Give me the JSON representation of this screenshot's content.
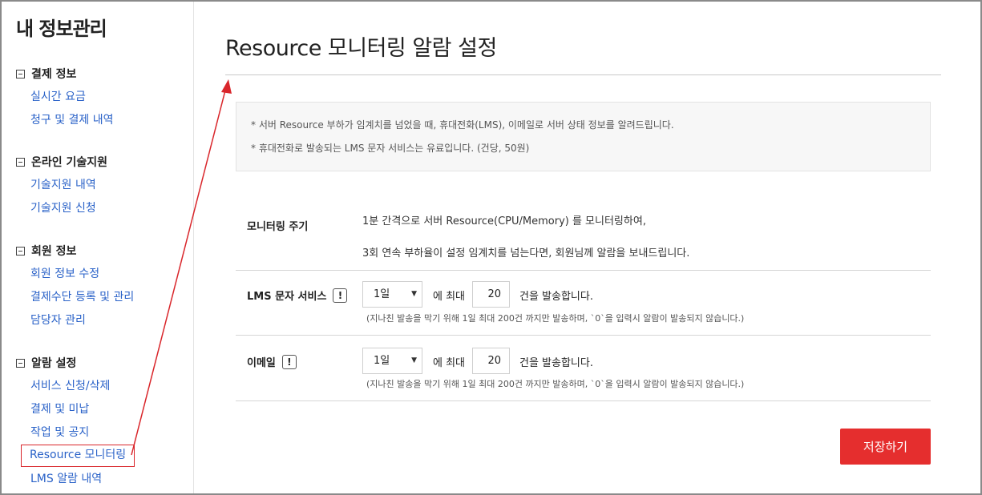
{
  "sidebar": {
    "title": "내 정보관리",
    "groups": [
      {
        "label": "결제 정보",
        "items": [
          "실시간 요금",
          "청구 및 결제 내역"
        ]
      },
      {
        "label": "온라인 기술지원",
        "items": [
          "기술지원 내역",
          "기술지원 신청"
        ]
      },
      {
        "label": "회원 정보",
        "items": [
          "회원 정보 수정",
          "결제수단 등록 및 관리",
          "담당자 관리"
        ]
      },
      {
        "label": "알람 설정",
        "items": [
          "서비스 신청/삭제",
          "결제 및 미납",
          "작업 및 공지",
          "Resource 모니터링",
          "LMS 알람 내역"
        ]
      }
    ]
  },
  "main": {
    "title": "Resource 모니터링 알람 설정",
    "notice": [
      "* 서버 Resource 부하가 임계치를 넘었을 때, 휴대전화(LMS), 이메일로 서버 상태 정보를 알려드립니다.",
      "* 휴대전화로 발송되는 LMS 문자 서비스는 유료입니다. (건당, 50원)"
    ],
    "monitoring": {
      "label": "모니터링 주기",
      "line1": "1분 간격으로 서버 Resource(CPU/Memory) 를 모니터링하여,",
      "line2": "3회 연속 부하율이 설정 임계치를 넘는다면, 회원님께 알람을 보내드립니다."
    },
    "lms": {
      "label": "LMS 문자 서비스",
      "info_icon": "!",
      "period": "1일",
      "max_prefix": "에 최대",
      "count": "20",
      "suffix": "건을 발송합니다.",
      "hint": "(지나친 발송을 막기 위해 1일 최대 200건 까지만 발송하며, `0`을 입력시 알람이 발송되지 않습니다.)"
    },
    "email": {
      "label": "이메일",
      "info_icon": "!",
      "period": "1일",
      "max_prefix": "에 최대",
      "count": "20",
      "suffix": "건을 발송합니다.",
      "hint": "(지나친 발송을 막기 위해 1일 최대 200건 까지만 발송하며, `0`을 입력시 알람이 발송되지 않습니다.)"
    },
    "save_label": "저장하기"
  },
  "colors": {
    "link": "#2a62c8",
    "accent": "#e52e2e",
    "annotation": "#d9262b"
  }
}
